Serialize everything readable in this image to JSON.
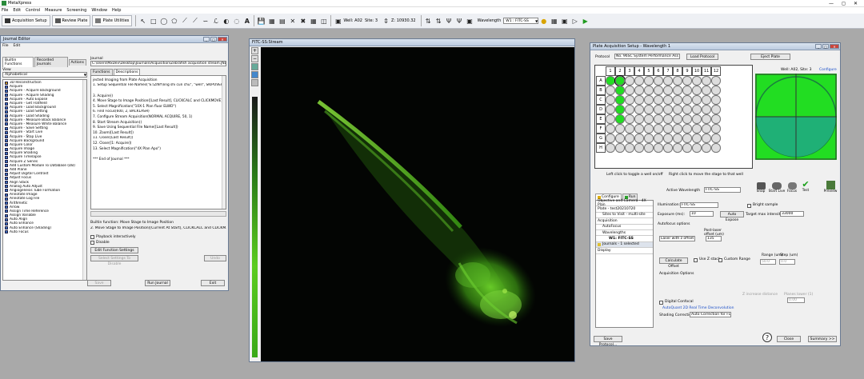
{
  "app": {
    "title": "MetaXpress"
  },
  "menu": [
    "File",
    "Edit",
    "Control",
    "Measure",
    "Screening",
    "Window",
    "Help"
  ],
  "toolbar": {
    "acq_setup": "Acquisition Setup",
    "review_plate": "Review Plate",
    "plate_utilities": "Plate Utilities",
    "well": "Well: A02",
    "site": "Site: 3",
    "z": "Z: 10930.32",
    "wavelength_label": "Wavelength",
    "wavelength_value": "W1 : FITC-SS"
  },
  "journal_editor": {
    "title": "Journal Editor",
    "menu": [
      "File",
      "Edit"
    ],
    "tabs": [
      "Builtin Functions",
      "Recorded Journals",
      "Actions"
    ],
    "view_label": "View",
    "view_value": "Alphabetical",
    "functions": [
      "3D Reconstruction",
      "Acquire",
      "Acquire - Acquire Background",
      "Acquire - Acquire Shading",
      "Acquire - Auto Expose",
      "Acquire - Get Flatfield",
      "Acquire - Load Background",
      "Acquire - Load Setting",
      "Acquire - Load Shading",
      "Acquire - Measure Black Balance",
      "Acquire - Measure White Balance",
      "Acquire - Save Setting",
      "Acquire - Start Live",
      "Acquire - Stop Live",
      "Acquire Background",
      "Acquire Color",
      "Acquire Image",
      "Acquire Shading",
      "Acquire Timelapse",
      "Acquire Z Series",
      "Add Custom Module To Database (DB)",
      "Add Plane",
      "Adjust Digital Contrast",
      "Adjust Focus",
      "Align Stack",
      "Analog Auto Adjust",
      "Angiogenesis Tube Formation",
      "Annotate Image",
      "Annotate Log File",
      "Arithmetic",
      "Arrow",
      "Assign Time Reference",
      "Assign Variable",
      "Auto Align",
      "Auto Enhance",
      "Auto Enhance (Shading)",
      "Auto Focus"
    ],
    "journal_label": "Journal",
    "journal_path": "C:\\Users\\MxDev\\Desktop\\Journals\\Acquisition\\Zebrafish acquisition stream.JNL",
    "jtabs": [
      "Functions",
      "Descriptions"
    ],
    "lines": [
      "jected Imaging from Plate Acquisition",
      "1. Setup Sequential File Names(\"E:\\ZINY\\ling shi cun chu\", \"well\", SKIPOVERW",
      "",
      "3. Acquire()",
      "4. Move Stage to Image Position([Last Result], CLICKCALC and CLICKMOVE)",
      "5. Select Magnification(\"10X-1 Plan fluor ELWD\")",
      "6. Find Focus(600, 2, BACKLASH)",
      "7. Configure Stream Acquisition(NORMAL ACQUIRE, 50, 1)",
      "8. Start Stream Acquisition()",
      "9. Save Using Sequential File Name([Last Result])",
      "10. Zoom([Last Result])",
      "11. Close([Last Result])",
      "12. Close([1: Acquire])",
      "13. Select Magnification(\"4X Plan Apo\")",
      "",
      "*** End of Journal ***"
    ],
    "builtin_fn": "Builtin function: Move Stage to Image Position",
    "step": "2. Move Stage to Image Position([Current At Start], CLICKCALC and CLICKM...",
    "playback": "Playback interactively",
    "disable": "Disable",
    "edit_settings": "Edit Function Settings",
    "select_settings": "Select Settings To Disable",
    "undo": "Undo",
    "save": "Save",
    "run": "Run Journal",
    "exit": "Exit"
  },
  "image_window": {
    "title": "FITC-SS:Stream"
  },
  "plate_setup": {
    "title": "Plate Acquisition Setup - Wavelength 1",
    "protocol_label": "Protocol",
    "protocol_value": "No. 96SC System Performance Ass",
    "load_protocol": "Load Protocol",
    "eject_plate": "Eject Plate",
    "well_site": "Well: A02, Site: 3",
    "configure_link": "Configure",
    "col_labels": [
      "1",
      "2",
      "3",
      "4",
      "5",
      "6",
      "7",
      "8",
      "9",
      "10",
      "11",
      "12"
    ],
    "row_labels": [
      "A",
      "B",
      "C",
      "D",
      "E",
      "F",
      "G",
      "H"
    ],
    "hint_left": "Left click to toggle a well on/off",
    "hint_right": "Right click to move the stage to that well",
    "active_wl_label": "Active Wavelength",
    "active_wl_value": "FITC-SS",
    "snap": "Snap",
    "start_live": "Start Live",
    "focus": "Focus",
    "test": "Test",
    "preview": "Preview",
    "tab_configure": "Configure",
    "tab_run": "Run",
    "nav": [
      "Objective and Camera - 4X Plan",
      "Plate - test20210720",
      "Sites to Visit - multi-site",
      "Acquisition",
      "AutoFocus",
      "Wavelengths",
      "W1: FITC-SS",
      "Journals - 1 selected",
      "Display"
    ],
    "illumination_label": "Illumination:",
    "illumination_value": "FITC-SS",
    "bright_sample": "Bright sample",
    "exposure_label": "Exposure (ms):",
    "exposure_value": "10",
    "auto_expose": "Auto Expose",
    "target_label": "Target max intensity:",
    "target_value": "33000",
    "autofocus_options": "Autofocus options",
    "laser_offset": "Laser with z offset",
    "post_laser": "Post-laser offset (um)",
    "offset_value": "135",
    "calc_offset": "Calculate Offset",
    "use_zstack": "Use Z stack",
    "custom_range": "Custom Range",
    "range_label": "Range (um)",
    "step_label": "Step (um)",
    "range_value": "50.0",
    "step_value": "0.0",
    "acq_options": "Acquisition Options",
    "z_increase": "Z increase distance",
    "planes_label": "Planes lower (1)",
    "planes_value": "0.00",
    "digital_confocal": "Digital Confocal",
    "autoquant": "AutoQuant 2D Real Time Deconvolution",
    "shading_label": "Shading Correction:",
    "shading_value": "Auto Correction for FL",
    "save_protocol": "Save Protocol...",
    "close": "Close",
    "summary": "Summary >>"
  }
}
